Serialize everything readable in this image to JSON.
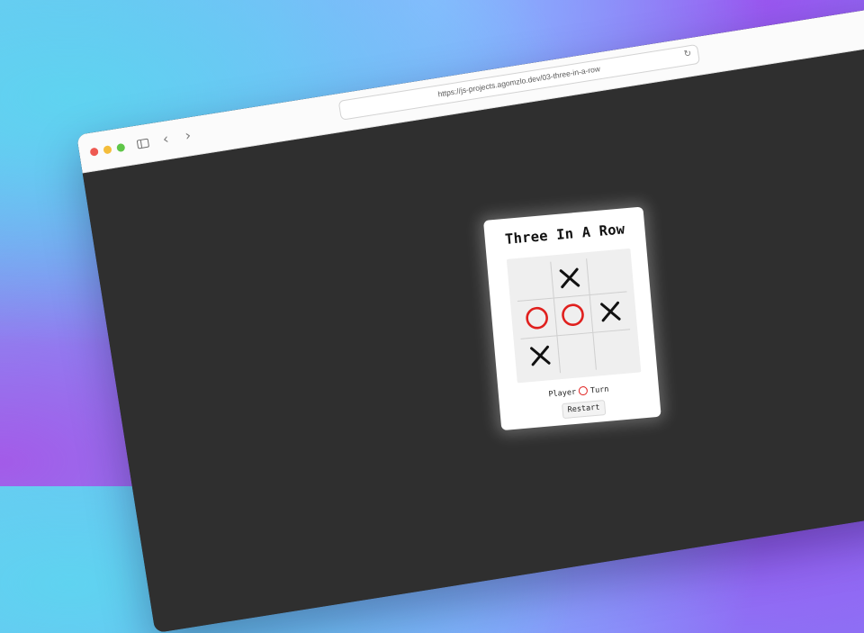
{
  "browser": {
    "url": "https://js-projects.agomzlo.dev/03-three-in-a-row",
    "back_label": "‹",
    "forward_label": "›",
    "reload_label": "↻"
  },
  "game": {
    "title": "Three In A Row",
    "board": [
      [
        "",
        "X",
        ""
      ],
      [
        "O",
        "O",
        "X"
      ],
      [
        "X",
        "",
        ""
      ]
    ],
    "status_prefix": "Player",
    "current_player": "O",
    "status_suffix": "Turn",
    "restart_label": "Restart",
    "colors": {
      "x": "#111111",
      "o": "#e0201e"
    }
  }
}
